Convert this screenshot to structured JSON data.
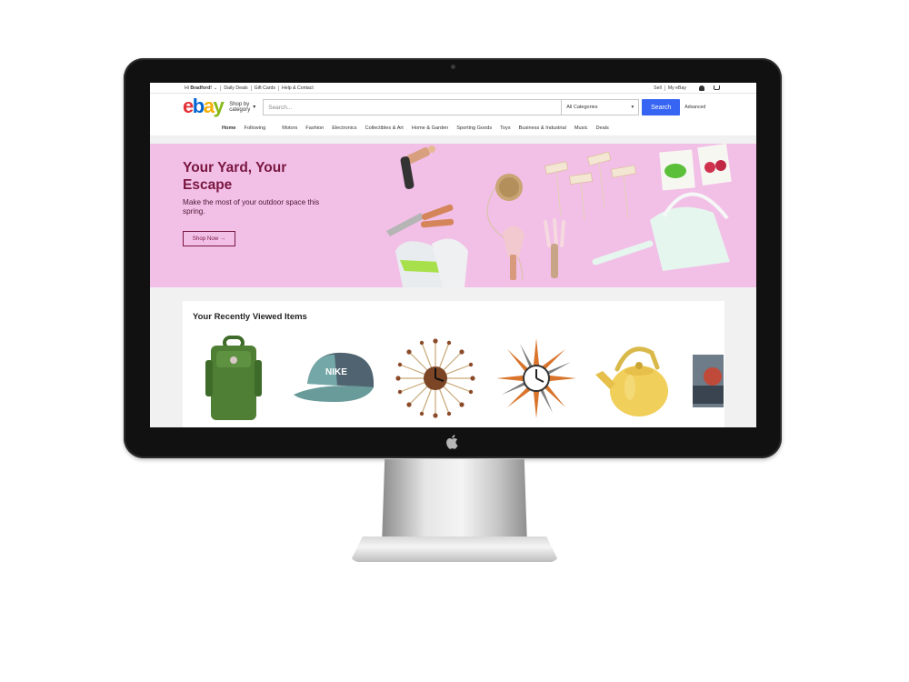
{
  "topbar": {
    "greeting": "Hi",
    "user": "Bradford!",
    "links": [
      "Daily Deals",
      "Gift Cards",
      "Help & Contact"
    ],
    "sell": "Sell",
    "my_ebay": "My eBay"
  },
  "header": {
    "logo": {
      "e": "e",
      "b": "b",
      "a": "a",
      "y": "y"
    },
    "shop_by": "Shop by",
    "category": "category",
    "search_placeholder": "Search...",
    "category_select": "All Categories",
    "search_button": "Search",
    "advanced": "Advanced"
  },
  "nav": {
    "items": [
      "Home",
      "Following",
      "Motors",
      "Fashion",
      "Electronics",
      "Collectibles & Art",
      "Home & Garden",
      "Sporting Goods",
      "Toys",
      "Business & Industrial",
      "Music",
      "Deals"
    ]
  },
  "hero": {
    "title": "Your Yard, Your Escape",
    "subtitle": "Make the most of your outdoor space this spring.",
    "button": "Shop Now →",
    "background": "#f2bfe7"
  },
  "recent": {
    "title": "Your Recently Viewed Items",
    "items": [
      "green-backpack",
      "nike-sb-cap",
      "sunburst-wall-clock",
      "starburst-wall-clock",
      "yellow-tea-kettle",
      "partial-item"
    ]
  },
  "colors": {
    "logo_red": "#e53238",
    "logo_blue": "#0064d2",
    "logo_yellow": "#f5af02",
    "logo_green": "#86b817",
    "search_button": "#3665f3",
    "hero_title": "#7a1740"
  }
}
